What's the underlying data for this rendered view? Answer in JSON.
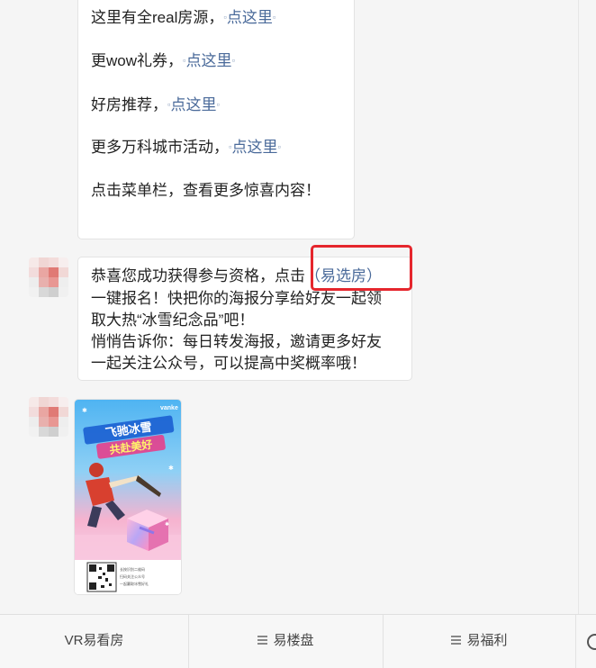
{
  "top_message": {
    "lines": [
      {
        "prefix": "这里有全real房源，",
        "link": "点这里"
      },
      {
        "prefix": "更wow礼券，",
        "link": "点这里"
      },
      {
        "prefix": "好房推荐，",
        "link": "点这里"
      },
      {
        "prefix": "更多万科城市活动，",
        "link": "点这里"
      }
    ],
    "footer": "点击菜单栏，查看更多惊喜内容！",
    "link_icon_left": "▫",
    "link_icon_right": "▫"
  },
  "congrats_message": {
    "line1_text": "恭喜您成功获得参与资格，点击",
    "line1_link": "（易选房）",
    "line2": "一键报名！快把你的海报分享给好友一起领",
    "line3": "取大热“冰雪纪念品”吧！",
    "line4": "悄悄告诉你：每日转发海报，邀请更多好友",
    "line5": "一起关注公众号，可以提高中奖概率哦！"
  },
  "poster": {
    "brand": "vanke",
    "headline1": "飞驰冰雪",
    "headline2": "共赴美好",
    "qr_caption1": "长按识别二维码",
    "qr_caption2": "扫码关注公众号",
    "qr_caption3": "一起赢取冰雪好礼"
  },
  "menu": {
    "items": [
      {
        "label": "VR易看房",
        "icon": "none"
      },
      {
        "label": "易楼盘",
        "icon": "hamburger-icon"
      },
      {
        "label": "易福利",
        "icon": "hamburger-icon"
      }
    ],
    "more_icon": "keyboard-toggle-icon"
  },
  "colors": {
    "link": "#4a6a9a",
    "highlight_box": "#e5262d",
    "background": "#f5f5f5"
  }
}
